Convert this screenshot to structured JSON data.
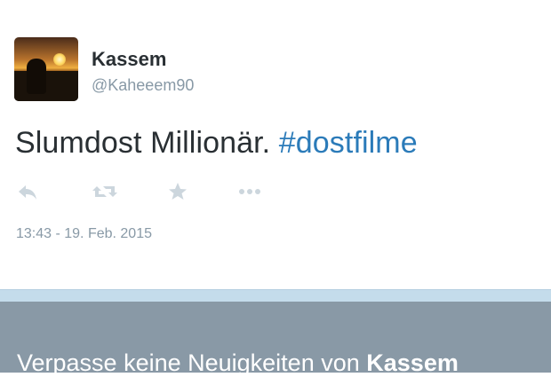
{
  "tweet": {
    "author": {
      "name": "Kassem",
      "handle": "@Kaheeem90",
      "avatar": "sunset-silhouette-photo"
    },
    "text": "Slumdost Millionär.",
    "hashtag": "#dostfilme",
    "actions": [
      {
        "icon": "reply-icon"
      },
      {
        "icon": "retweet-icon"
      },
      {
        "icon": "favorite-star-icon"
      },
      {
        "icon": "more-dots-icon"
      }
    ],
    "timestamp": "13:43 - 19. Feb. 2015"
  },
  "banner": {
    "prefix": "Verpasse keine Neuigkeiten von",
    "name": "Kassem"
  },
  "colors": {
    "link": "#2b7bb9",
    "text": "#292f33",
    "muted": "#8899a6",
    "icon": "#ccd6dd",
    "band": "#c4dceb",
    "banner": "#8999a6"
  }
}
